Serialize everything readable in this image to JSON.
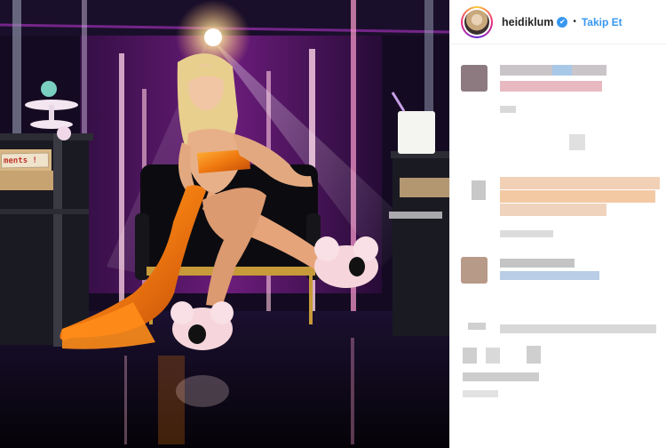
{
  "photo": {
    "box_label": "ments !"
  },
  "header": {
    "username": "heidiklum",
    "verified_mark": "✔",
    "separator": "•",
    "follow_label": "Takip Et"
  },
  "colors": {
    "follow": "#3897f0",
    "dress": "#f07a10",
    "stage": "#120a1e"
  }
}
